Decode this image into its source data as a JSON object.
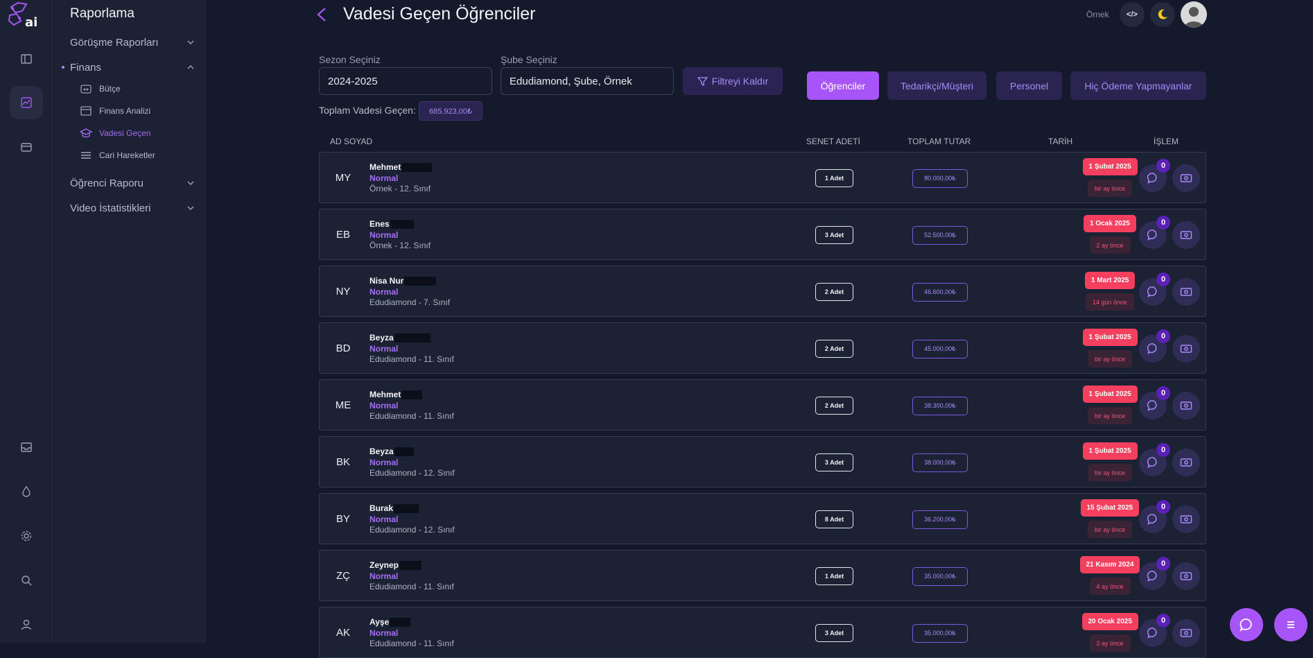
{
  "sidebar": {
    "title": "Raporlama",
    "sections": [
      {
        "label": "Görüşme Raporları"
      },
      {
        "label": "Finans"
      },
      {
        "label": "Öğrenci Raporu"
      },
      {
        "label": "Video İstatistikleri"
      }
    ],
    "finans_items": [
      {
        "label": "Bütçe",
        "icon": "budget-icon"
      },
      {
        "label": "Finans Analizi",
        "icon": "finance-analysis-icon"
      },
      {
        "label": "Vadesi Geçen",
        "icon": "graduation-cap-icon",
        "active": true
      },
      {
        "label": "Cari Hareketler",
        "icon": "list-icon"
      }
    ]
  },
  "header": {
    "title": "Vadesi Geçen Öğrenciler",
    "org_label": "Örnek",
    "code_icon_text": "</>"
  },
  "filters": {
    "season_label": "Sezon Seçiniz",
    "season_value": "2024-2025",
    "branch_label": "Şube Seçiniz",
    "branch_value": "Edudiamond, Şube, Örnek",
    "clear_label": "Filtreyi Kaldır"
  },
  "tabs": [
    {
      "label": "Öğrenciler",
      "active": true
    },
    {
      "label": "Tedarikçi/Müşteri"
    },
    {
      "label": "Personel"
    },
    {
      "label": "Hiç Ödeme Yapmayanlar"
    }
  ],
  "summary": {
    "total_label": "Toplam Vadesi Geçen:",
    "total_value": "685.923,00₺"
  },
  "table": {
    "headers": [
      "AD SOYAD",
      "SENET ADETİ",
      "TOPLAM TUTAR",
      "TARİH",
      "İŞLEM"
    ],
    "rows": [
      {
        "initials": "MY",
        "name": "Mehmet",
        "type": "Normal",
        "class": "Örnek - 12. Sınıf",
        "count": "1 Adet",
        "total": "80.000,00₺",
        "date": "1 Şubat 2025",
        "ago": "bir ay önce",
        "messages": "0"
      },
      {
        "initials": "EB",
        "name": "Enes",
        "type": "Normal",
        "class": "Örnek - 12. Sınıf",
        "count": "3 Adet",
        "total": "52.500,00₺",
        "date": "1 Ocak 2025",
        "ago": "2 ay önce",
        "messages": "0"
      },
      {
        "initials": "NY",
        "name": "Nisa Nur",
        "type": "Normal",
        "class": "Edudiamond - 7. Sınıf",
        "count": "2 Adet",
        "total": "46.600,00₺",
        "date": "1 Mart 2025",
        "ago": "14 gün önce",
        "messages": "0"
      },
      {
        "initials": "BD",
        "name": "Beyza",
        "type": "Normal",
        "class": "Edudiamond - 11. Sınıf",
        "count": "2 Adet",
        "total": "45.000,00₺",
        "date": "1 Şubat 2025",
        "ago": "bir ay önce",
        "messages": "0"
      },
      {
        "initials": "ME",
        "name": "Mehmet",
        "type": "Normal",
        "class": "Edudiamond - 11. Sınıf",
        "count": "2 Adet",
        "total": "38.300,00₺",
        "date": "1 Şubat 2025",
        "ago": "bir ay önce",
        "messages": "0"
      },
      {
        "initials": "BK",
        "name": "Beyza",
        "type": "Normal",
        "class": "Edudiamond - 12. Sınıf",
        "count": "3 Adet",
        "total": "38.000,00₺",
        "date": "1 Şubat 2025",
        "ago": "bir ay önce",
        "messages": "0"
      },
      {
        "initials": "BY",
        "name": "Burak",
        "type": "Normal",
        "class": "Edudiamond - 12. Sınıf",
        "count": "8 Adet",
        "total": "36.200,00₺",
        "date": "15 Şubat 2025",
        "ago": "bir ay önce",
        "messages": "0"
      },
      {
        "initials": "ZÇ",
        "name": "Zeynep",
        "type": "Normal",
        "class": "Edudiamond - 11. Sınıf",
        "count": "1 Adet",
        "total": "35.000,00₺",
        "date": "21 Kasım 2024",
        "ago": "4 ay önce",
        "messages": "0"
      },
      {
        "initials": "AK",
        "name": "Ayşe",
        "type": "Normal",
        "class": "Edudiamond - 11. Sınıf",
        "count": "3 Adet",
        "total": "35.000,00₺",
        "date": "20 Ocak 2025",
        "ago": "2 ay önce",
        "messages": "0"
      }
    ]
  },
  "colors": {
    "accent": "#a855f7",
    "danger": "#f43f5e",
    "background": "#141a2b"
  }
}
